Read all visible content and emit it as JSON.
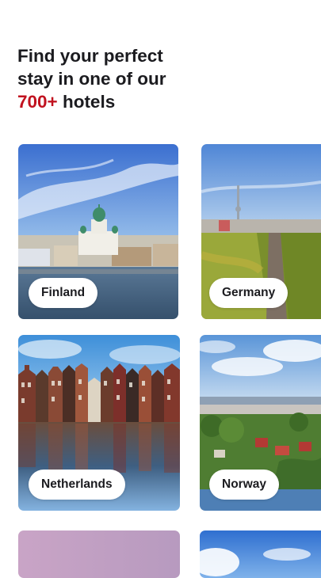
{
  "header": {
    "title_line1": "Find your perfect",
    "title_line2_prefix": "stay in one of our",
    "title_accent": "700+",
    "title_suffix": "hotels"
  },
  "destinations": [
    {
      "label": "Finland"
    },
    {
      "label": "Germany"
    },
    {
      "label": "Netherlands"
    },
    {
      "label": "Norway"
    }
  ],
  "colors": {
    "accent": "#c1121f",
    "text": "#1b1b1f",
    "pill_bg": "#ffffff"
  }
}
